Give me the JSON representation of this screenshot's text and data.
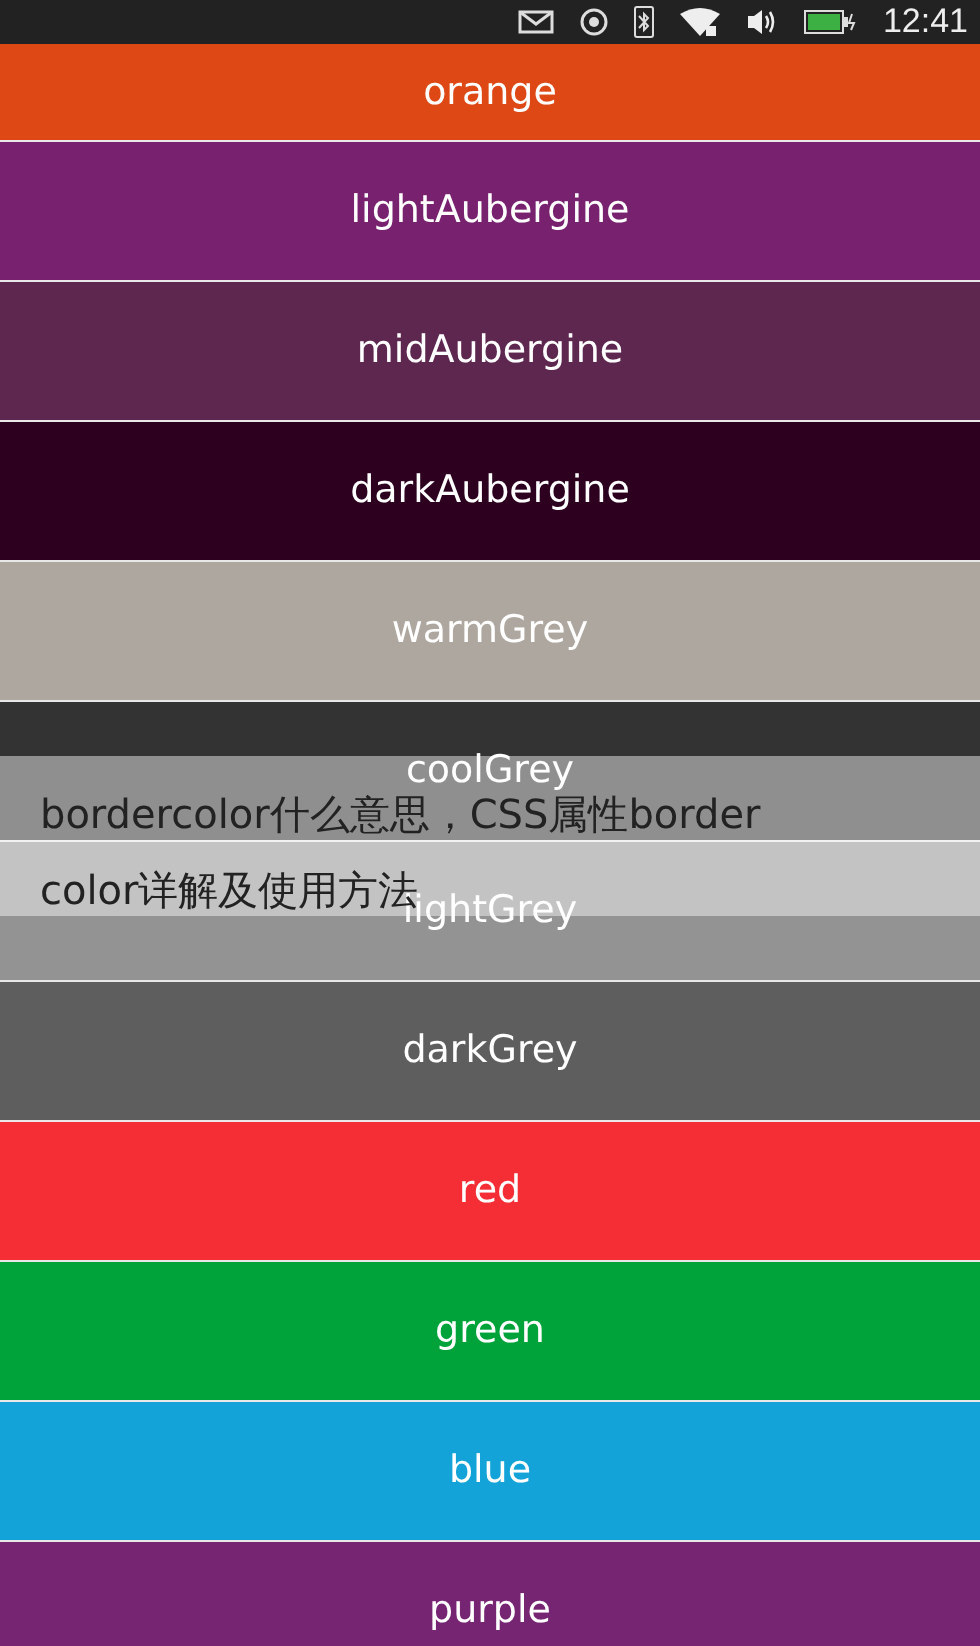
{
  "status_bar": {
    "time": "12:41"
  },
  "colors": [
    {
      "label": "orange",
      "color": "#dd4814"
    },
    {
      "label": "lightAubergine",
      "color": "#77216f"
    },
    {
      "label": "midAubergine",
      "color": "#5e2750"
    },
    {
      "label": "darkAubergine",
      "color": "#2c001e"
    },
    {
      "label": "warmGrey",
      "color": "#aea79f"
    },
    {
      "label": "coolGrey",
      "color": "#333333"
    },
    {
      "label": "lightGrey",
      "color": "#939393"
    },
    {
      "label": "darkGrey",
      "color": "#5e5e5e"
    },
    {
      "label": "red",
      "color": "#f52d35"
    },
    {
      "label": "green",
      "color": "#00a33a"
    },
    {
      "label": "blue",
      "color": "#13a3d9"
    },
    {
      "label": "purple",
      "color": "#762572"
    }
  ],
  "caption_lines": [
    "bordercolor什么意思，CSS属性border",
    "color详解及使用方法"
  ]
}
